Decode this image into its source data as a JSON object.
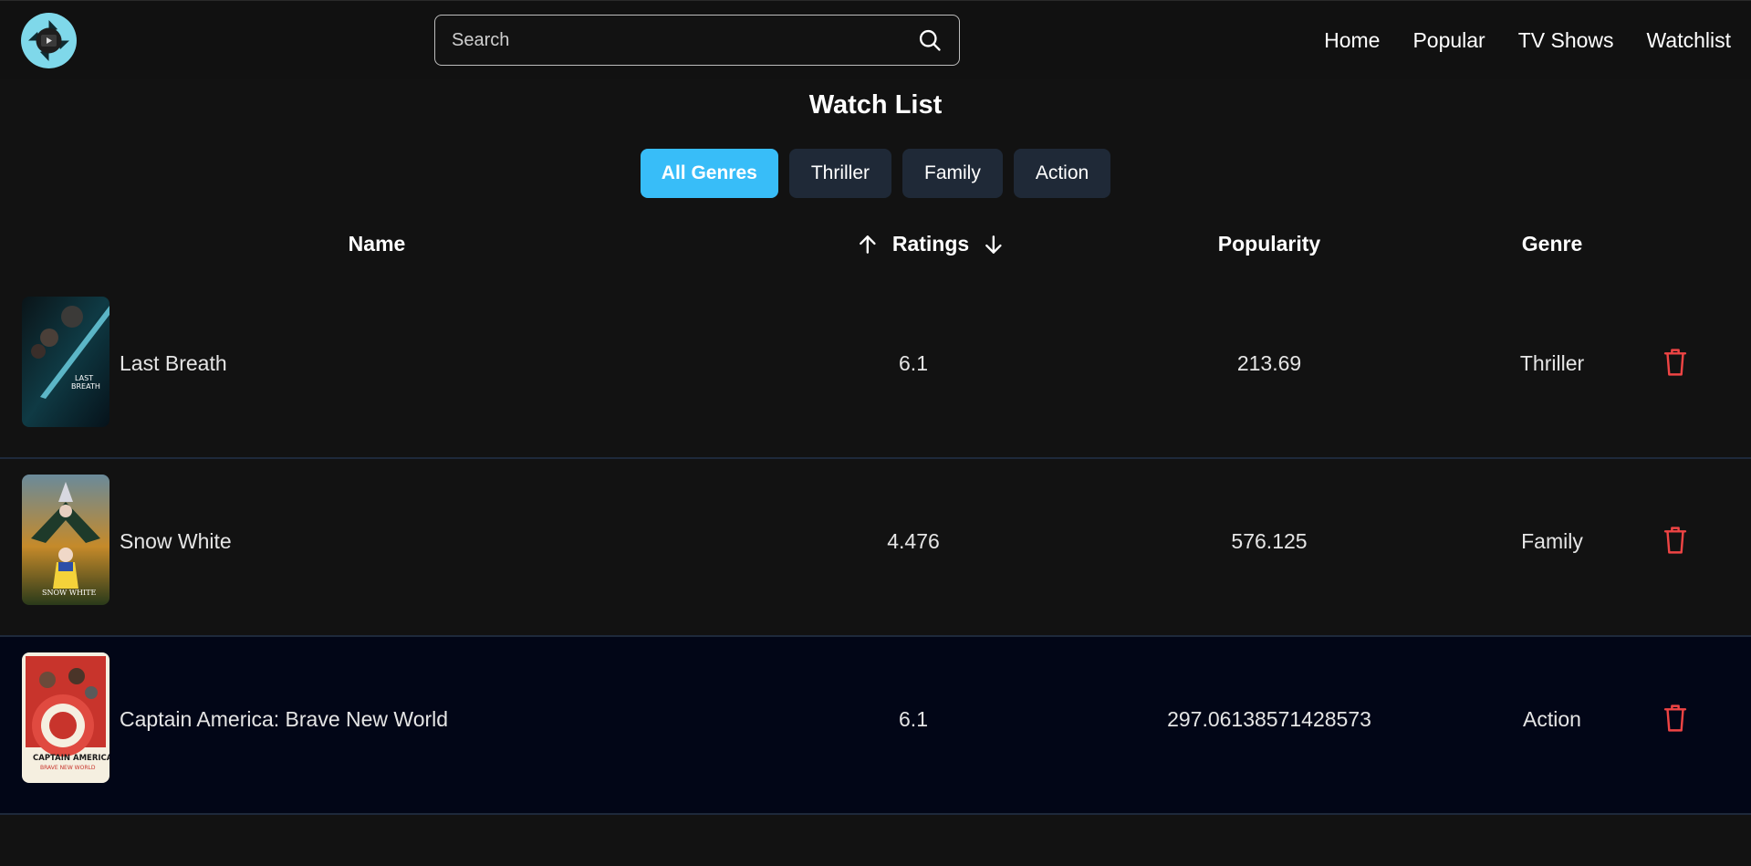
{
  "search": {
    "placeholder": "Search"
  },
  "nav": {
    "home": "Home",
    "popular": "Popular",
    "tv_shows": "TV Shows",
    "watchlist": "Watchlist"
  },
  "page": {
    "title": "Watch List"
  },
  "filters": {
    "all": "All Genres",
    "thriller": "Thriller",
    "family": "Family",
    "action": "Action"
  },
  "table": {
    "headers": {
      "name": "Name",
      "ratings": "Ratings",
      "popularity": "Popularity",
      "genre": "Genre"
    },
    "rows": [
      {
        "name": "Last Breath",
        "rating": "6.1",
        "popularity": "213.69",
        "genre": "Thriller",
        "poster_text": "LAST BREATH"
      },
      {
        "name": "Snow White",
        "rating": "4.476",
        "popularity": "576.125",
        "genre": "Family",
        "poster_text": "SNOW WHITE"
      },
      {
        "name": "Captain America: Brave New World",
        "rating": "6.1",
        "popularity": "297.06138571428573",
        "genre": "Action",
        "poster_text": "CAPTAIN AMERICA"
      }
    ]
  },
  "colors": {
    "background": "#121212",
    "accent": "#38bdf8",
    "chip": "#1f2937",
    "delete": "#ef4444",
    "row_divider": "#1e293b"
  },
  "icons": {
    "logo": "camera-aperture-logo",
    "search": "search-icon",
    "sort_up": "arrow-up-icon",
    "sort_down": "arrow-down-icon",
    "delete": "trash-icon"
  }
}
